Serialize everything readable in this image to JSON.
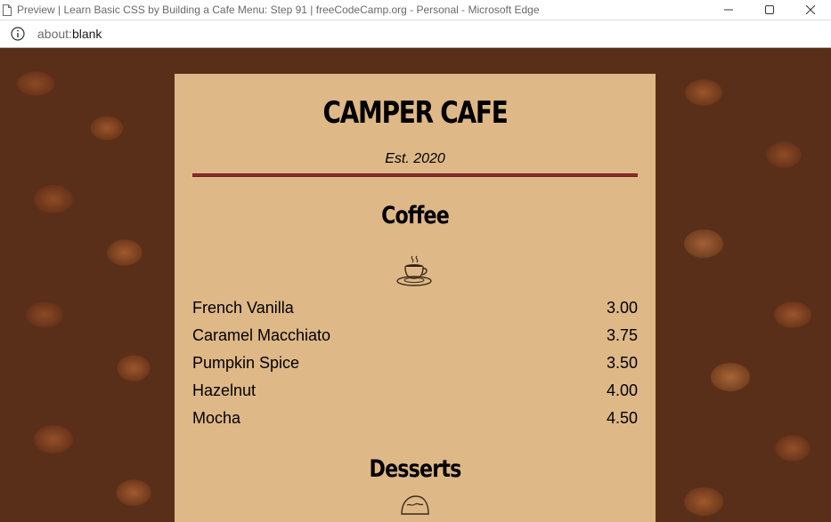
{
  "window": {
    "title": "Preview | Learn Basic CSS by Building a Cafe Menu: Step 91 | freeCodeCamp.org - Personal - Microsoft Edge"
  },
  "address_bar": {
    "url_scheme": "about:",
    "url_path": "blank"
  },
  "menu": {
    "cafe_name": "CAMPER CAFE",
    "established": "Est. 2020",
    "coffee": {
      "title": "Coffee",
      "icon": "coffee-cup-icon",
      "items": [
        {
          "name": "French Vanilla",
          "price": "3.00"
        },
        {
          "name": "Caramel Macchiato",
          "price": "3.75"
        },
        {
          "name": "Pumpkin Spice",
          "price": "3.50"
        },
        {
          "name": "Hazelnut",
          "price": "4.00"
        },
        {
          "name": "Mocha",
          "price": "4.50"
        }
      ]
    },
    "desserts": {
      "title": "Desserts",
      "icon": "pie-icon"
    }
  },
  "colors": {
    "card_background": "#deb887",
    "divider": "#8e2d2d"
  }
}
